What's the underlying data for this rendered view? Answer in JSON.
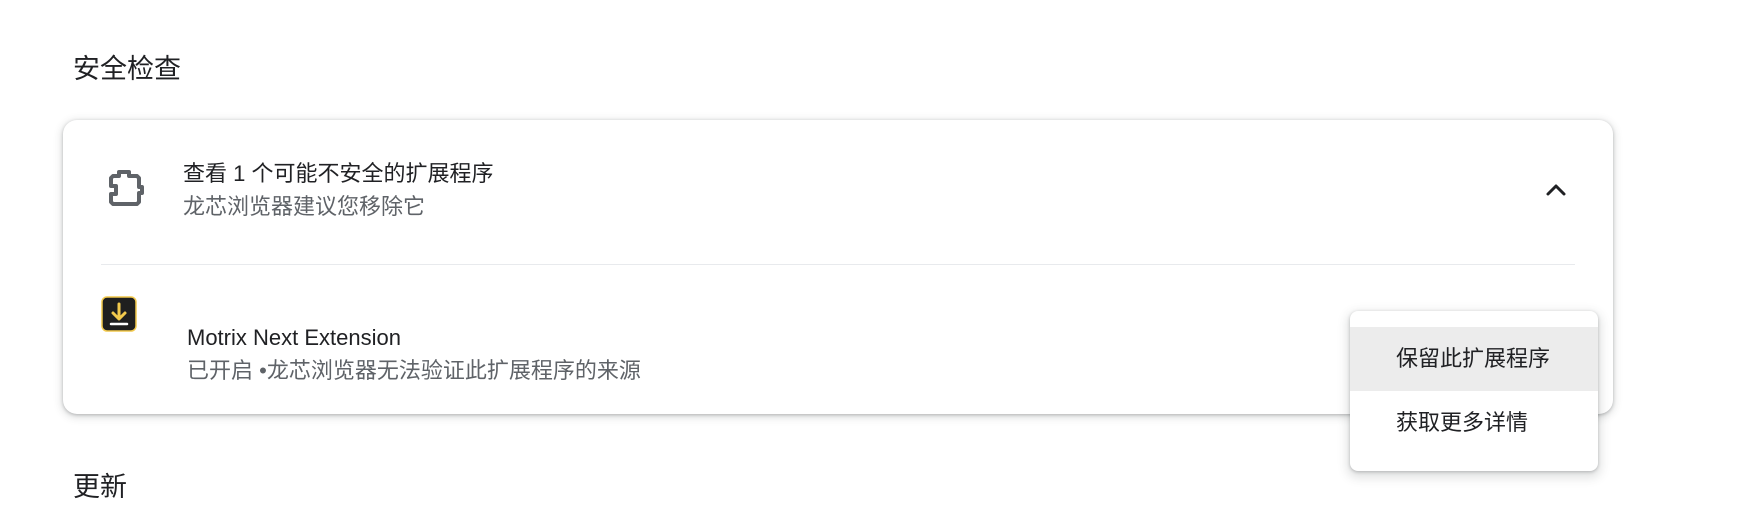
{
  "sections": {
    "safety_check_title": "安全检查",
    "updates_title": "更新"
  },
  "unsafe_extensions": {
    "title": "查看 1 个可能不安全的扩展程序",
    "subtitle": "龙芯浏览器建议您移除它",
    "expanded": true,
    "icon": "puzzle-piece-icon",
    "collapse_icon": "chevron-up-icon"
  },
  "extension": {
    "name": "Motrix Next Extension",
    "status": "已开启 •龙芯浏览器无法验证此扩展程序的来源",
    "icon": "download-arrow-icon",
    "icon_colors": {
      "background": "#1f1f1f",
      "accent": "#f2c94c"
    }
  },
  "action_menu": {
    "items": [
      {
        "label": "保留此扩展程序",
        "highlighted": true
      },
      {
        "label": "获取更多详情",
        "highlighted": false
      }
    ]
  }
}
